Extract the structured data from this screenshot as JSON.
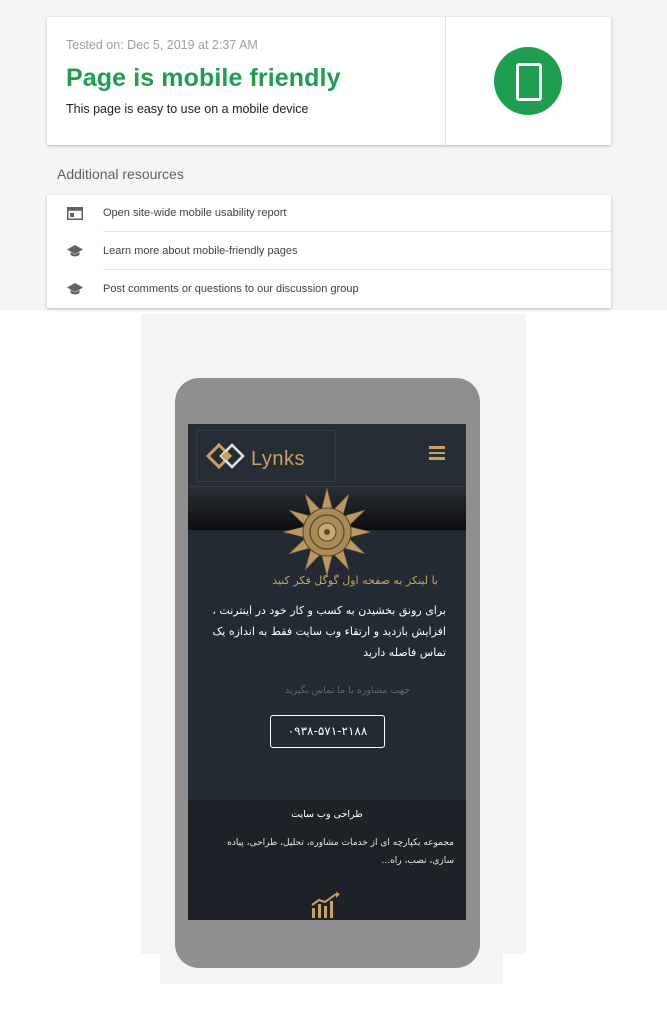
{
  "result": {
    "tested_on": "Tested on: Dec 5, 2019 at 2:37 AM",
    "title": "Page is mobile friendly",
    "description": "This page is easy to use on a mobile device",
    "status_color": "#1e9e4f",
    "icon": "smartphone-icon"
  },
  "additional": {
    "title": "Additional resources",
    "items": [
      {
        "label": "Open site-wide mobile usability report",
        "icon": "report-icon"
      },
      {
        "label": "Learn more about mobile-friendly pages",
        "icon": "school-icon"
      },
      {
        "label": "Post comments or questions to our discussion group",
        "icon": "school-icon"
      }
    ]
  },
  "preview": {
    "logo_text": "Lynks",
    "accent_color": "#c9a15f",
    "tagline": "با لینکز به صفحه اول گوگل فکر کنید",
    "intro": "برای رونق بخشیدن به کسب و کار خود در اینترنت ، افزایش بازدید و ارتقاء وب سایت فقط به اندازه یک تماس فاصله دارید",
    "contact_hint": "جهت مشاوره با ما تماس بگیرید",
    "phone_button": "۰۹۳۸-۵۷۱-۲۱۸۸",
    "service_title": "طراحی وب سایت",
    "service_desc": "مجموعه یکپارچه ای از خدمات مشاوره، تحلیل، طراحی، پیاده سازی، نصب، راه..."
  }
}
